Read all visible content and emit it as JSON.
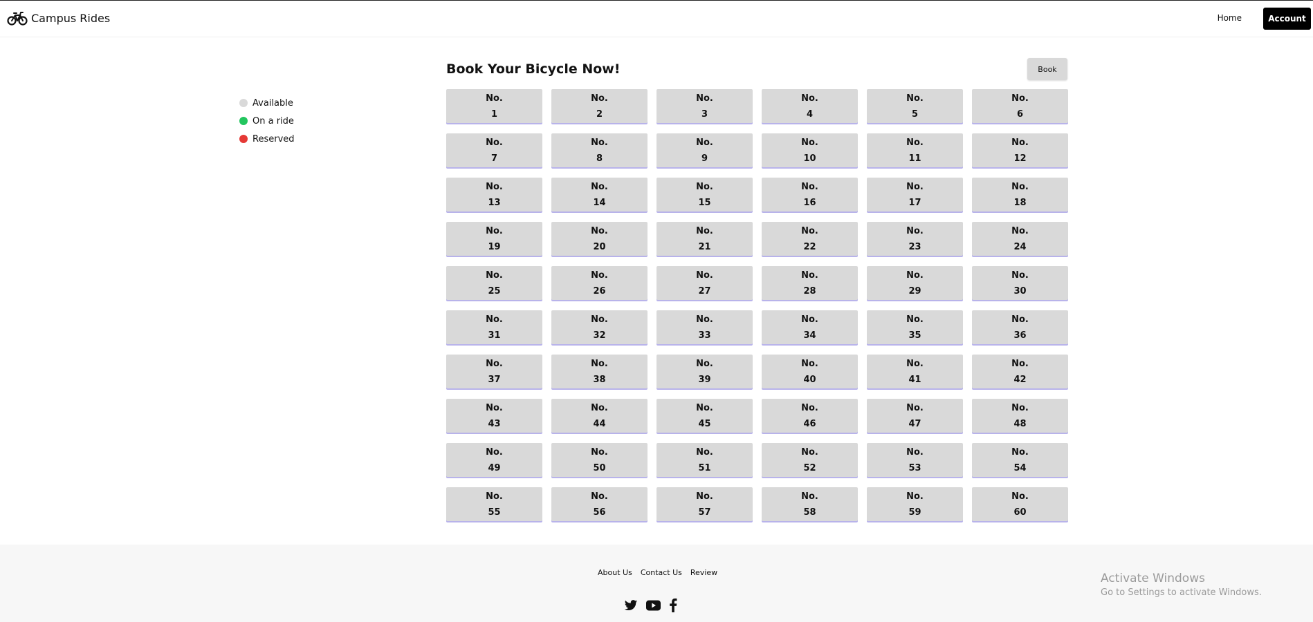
{
  "header": {
    "brand_name": "Campus Rides",
    "logo_icon": "bicycle-icon",
    "nav_home": "Home",
    "nav_account": "Account"
  },
  "legend": [
    {
      "label": "Available",
      "color": "#d9d9d9"
    },
    {
      "label": "On a ride",
      "color": "#22c55e"
    },
    {
      "label": "Reserved",
      "color": "#e53935"
    }
  ],
  "main": {
    "title": "Book Your Bicycle Now!",
    "book_label": "Book",
    "bike_prefix": "No.",
    "bikes": [
      "1",
      "2",
      "3",
      "4",
      "5",
      "6",
      "7",
      "8",
      "9",
      "10",
      "11",
      "12",
      "13",
      "14",
      "15",
      "16",
      "17",
      "18",
      "19",
      "20",
      "21",
      "22",
      "23",
      "24",
      "25",
      "26",
      "27",
      "28",
      "29",
      "30",
      "31",
      "32",
      "33",
      "34",
      "35",
      "36",
      "37",
      "38",
      "39",
      "40",
      "41",
      "42",
      "43",
      "44",
      "45",
      "46",
      "47",
      "48",
      "49",
      "50",
      "51",
      "52",
      "53",
      "54",
      "55",
      "56",
      "57",
      "58",
      "59",
      "60"
    ]
  },
  "footer": {
    "links": [
      "About Us",
      "Contact Us",
      "Review"
    ],
    "social_icons": [
      "twitter-icon",
      "youtube-icon",
      "facebook-icon"
    ]
  },
  "watermark": {
    "title": "Activate Windows",
    "subtitle": "Go to Settings to activate Windows."
  }
}
